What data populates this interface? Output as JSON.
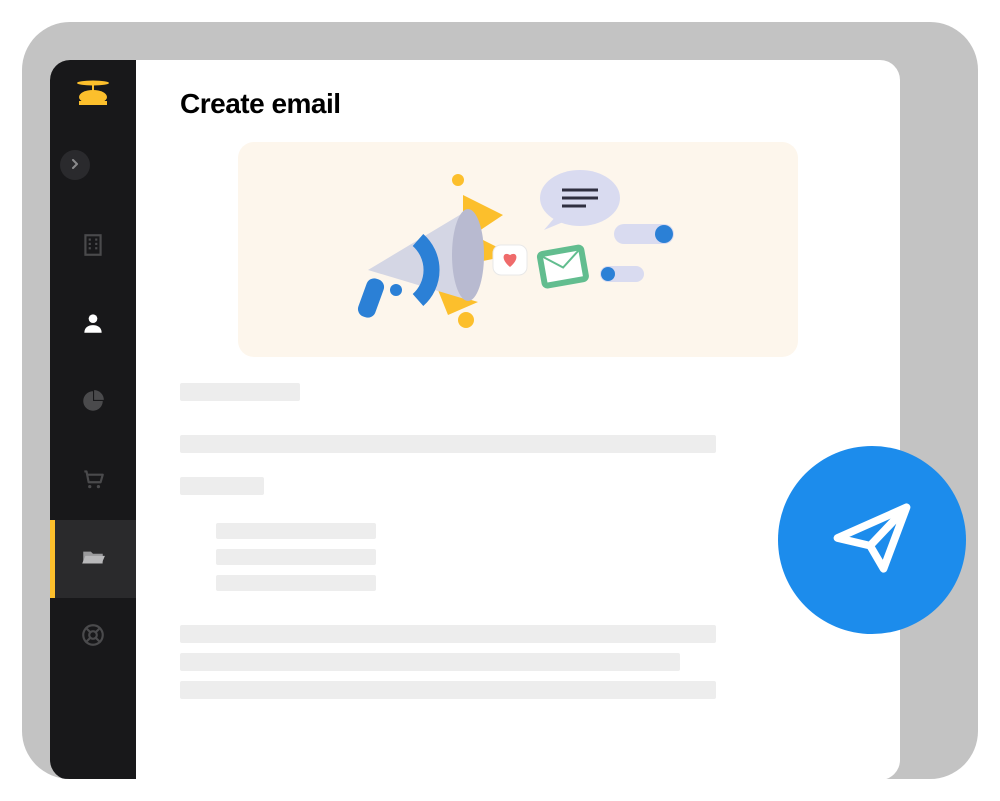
{
  "page": {
    "title": "Create email"
  },
  "sidebar": {
    "items": [
      {
        "name": "organization",
        "icon": "building-icon",
        "active": false,
        "iconColor": "#4a4a4c"
      },
      {
        "name": "contacts",
        "icon": "person-icon",
        "active": false,
        "iconColor": "#ffffff"
      },
      {
        "name": "analytics",
        "icon": "pie-chart-icon",
        "active": false,
        "iconColor": "#4a4a4c"
      },
      {
        "name": "commerce",
        "icon": "cart-icon",
        "active": false,
        "iconColor": "#4a4a4c"
      },
      {
        "name": "content",
        "icon": "folder-icon",
        "active": true,
        "iconColor": "#9a9a9c"
      },
      {
        "name": "support",
        "icon": "help-icon",
        "active": false,
        "iconColor": "#4a4a4c"
      }
    ]
  },
  "fab": {
    "name": "send"
  },
  "colors": {
    "accent": "#fcbf2c",
    "primary": "#1c8cec"
  }
}
